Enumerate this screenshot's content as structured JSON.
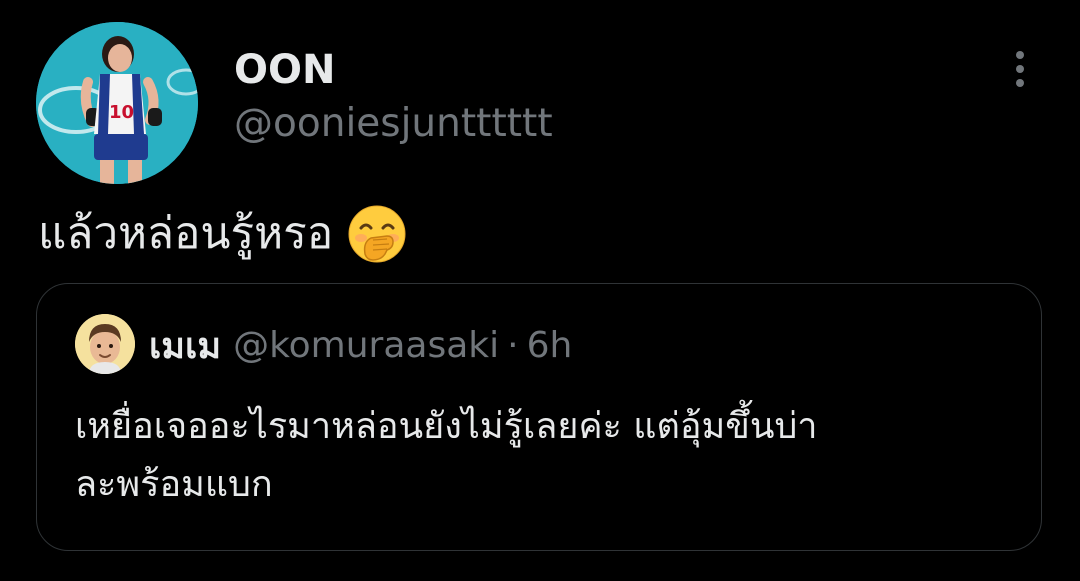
{
  "tweet": {
    "author": {
      "display_name": "OON",
      "handle": "@ooniesjuntttttt",
      "avatar_icon": "volleyball-player-avatar"
    },
    "more_icon": "more-vertical-icon",
    "text": "แล้วหล่อนรู้หรอ",
    "emoji": "face-with-hand-over-mouth-emoji",
    "quoted": {
      "display_name": "เมเม",
      "handle": "@komuraasaki",
      "separator": "·",
      "time": "6h",
      "avatar_icon": "memoji-avatar",
      "text_lines": [
        "เหยื่อเจออะไรมาหล่อนยังไม่รู้เลยค่ะ แต่อุ้มขึ้นบ่า",
        "ละพร้อมแบก"
      ]
    }
  },
  "colors": {
    "background": "#000000",
    "primary_text": "#e7e9ea",
    "secondary_text": "#71767b",
    "border": "#2f3336"
  }
}
